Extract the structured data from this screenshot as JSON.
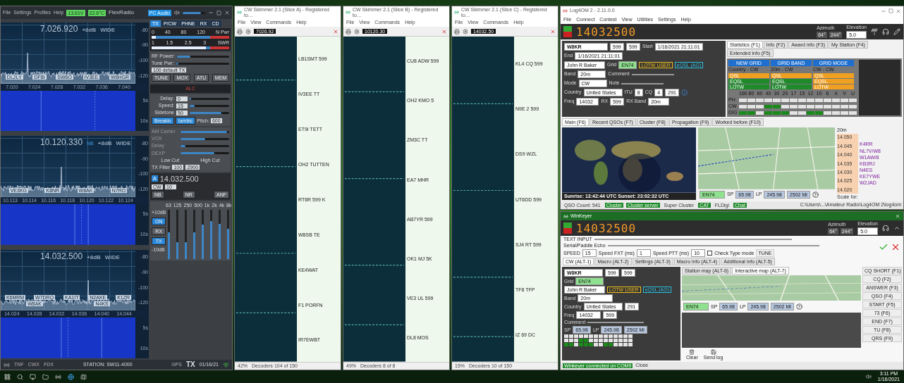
{
  "sdr": {
    "menu": [
      "File",
      "Settings",
      "Profiles",
      "Help"
    ],
    "status": [
      "13.61V",
      "22.6°C"
    ],
    "brand": "FlexRadio",
    "audio": "PC Audio",
    "volume": {
      "level": 0.8
    },
    "pans": [
      {
        "freq": "7.026.920",
        "gain": "+8dB",
        "width": "WIDE",
        "scale": [
          "-80",
          "-90",
          "-100",
          "-120"
        ],
        "ticks": [
          "7.020",
          "7.024",
          "7.028",
          "7.032",
          "7.036",
          "7.040"
        ],
        "wf_scale": [
          "5s",
          "10s"
        ],
        "spots": [
          "DL2LY",
          "DF8I",
          "SW6O",
          "IV3EE",
          "W8HGR"
        ]
      },
      {
        "freq": "10.120.330",
        "tag": "NB",
        "gain": "+8dB",
        "width": "WIDE",
        "scale": [
          "-80",
          "-90",
          "-100",
          "-120"
        ],
        "ticks": [
          "10.113",
          "10.114",
          "10.116",
          "10.118",
          "10.120",
          "10.122",
          "10.124"
        ],
        "wf_scale": [
          "5s",
          "10s"
        ],
        "spots": [
          "VE3KG",
          "K8NR",
          "W8AK",
          "N7RO"
        ]
      },
      {
        "freq": "14.032.500",
        "gain": "+8dB",
        "width": "WIDE",
        "scale": [
          "-80",
          "-90",
          "-100",
          "-120"
        ],
        "ticks": [
          "14.024",
          "14.028",
          "14.032",
          "14.036",
          "14.040",
          "14.044"
        ],
        "wf_scale": [
          "5s",
          "10s"
        ],
        "spots": [
          "K6MRM",
          "W7DRQ",
          "KA1IT",
          "N2AKE",
          "K1ZR",
          "W8AK",
          "N4KS"
        ]
      }
    ],
    "tabs": [
      {
        "label": "TX",
        "selected": true
      },
      {
        "label": "P/CW",
        "selected": false
      },
      {
        "label": "PHNE",
        "selected": false
      },
      {
        "label": "RX",
        "selected": false
      },
      {
        "label": "CD",
        "selected": false
      }
    ],
    "meters": [
      {
        "label": "N Pwr",
        "ticks": [
          "0",
          "40",
          "80",
          "120"
        ],
        "level": 0.05
      },
      {
        "label": "SWR",
        "ticks": [
          "1",
          "1.5",
          "2.5",
          "3"
        ],
        "level": 0.7
      }
    ],
    "tx_rows": [
      {
        "label": "RF Power:",
        "level": 0.25
      },
      {
        "label": "Tune Pwr:",
        "level": 0.05
      }
    ],
    "profile": "100 default TX",
    "tx_buttons": [
      {
        "label": "TUNE",
        "on": false
      },
      {
        "label": "MOX",
        "on": false
      },
      {
        "label": "ATU",
        "on": false
      },
      {
        "label": "MEM",
        "on": false
      }
    ],
    "alc_label": "ALC",
    "cw_rows": [
      {
        "label": "Delay:",
        "value": "0",
        "level": 0.03
      },
      {
        "label": "Speed:",
        "value": "15",
        "level": 0.12
      },
      {
        "label": "Sidetone",
        "value": "50",
        "level": 0.8
      }
    ],
    "cw_buttons": [
      {
        "label": "Breakin",
        "on": true
      },
      {
        "label": "Iambic",
        "on": true
      }
    ],
    "pitch_label": "Pitch:",
    "pitch": "600",
    "phone_rows": [
      {
        "label": "AM Carrier",
        "level": 0.95
      },
      {
        "label": "VOX",
        "level": 0.5
      },
      {
        "label": "Delay",
        "level": 0.1
      },
      {
        "label": "DEXP",
        "level": 0.7
      }
    ],
    "filter": {
      "label": "TX Filter",
      "low_label": "Low Cut",
      "low": "100",
      "high_label": "High Cut",
      "high": "2900"
    },
    "slice": {
      "letter": "A",
      "freq": "14.032.500",
      "mode": "CW",
      "step": "10",
      "buttons": [
        {
          "label": "NB",
          "on": false
        },
        {
          "label": "NR",
          "on": false
        },
        {
          "label": "ANF",
          "on": false
        }
      ]
    },
    "eq": {
      "bands": [
        {
          "label": "63",
          "level": 0.55
        },
        {
          "label": "125",
          "level": 0.35
        },
        {
          "label": "250",
          "level": 0.35
        },
        {
          "label": "500",
          "level": 0.55
        },
        {
          "label": "1k",
          "level": 0.7
        },
        {
          "label": "2k",
          "level": 0.78
        },
        {
          "label": "4k",
          "level": 0.72
        },
        {
          "label": "8k",
          "level": 0.62
        }
      ],
      "top": "+10dB",
      "bottom": "-10dB",
      "buttons": [
        {
          "label": "ON",
          "on": true
        },
        {
          "label": "RX",
          "on": false
        },
        {
          "label": "TX",
          "on": true
        }
      ]
    },
    "statusbar": [
      {
        "text": "TNF",
        "kind": "mode"
      },
      {
        "text": "CWX",
        "kind": "mode"
      },
      {
        "text": "FDX",
        "kind": "mode"
      },
      {
        "text": "STATION: SW11-4000",
        "kind": "station"
      },
      {
        "text": "GPS",
        "kind": "mode"
      },
      {
        "text": "TX",
        "kind": "tx"
      },
      {
        "text": "01/16/21",
        "kind": "clock"
      }
    ]
  },
  "skimmers": [
    {
      "title": "CW Skimmer 2.1 (Slice A) - Registered to…",
      "menu": [
        "File",
        "View",
        "Commands",
        "Help"
      ],
      "freq": "7026.92",
      "spots": [
        "LB1SMT 599",
        "IV3EE TT",
        "ET9I TETT",
        "OH2 TUTTEN",
        "RT6R 599 K",
        "W8SB TE",
        "KE4WAT",
        "F1 PORFN",
        "IR7EWBT"
      ],
      "status": [
        "42%",
        "Decoders 104 of 150"
      ]
    },
    {
      "title": "CW Skimmer 2.1 (Slice B) - Registered to…",
      "menu": [
        "File",
        "View",
        "Commands",
        "Help"
      ],
      "freq": "10120.30",
      "spots": [
        "CU8 ADW 599",
        "OH2 KMO 5",
        "ZM3C TT",
        "EA7 MHR",
        "AB7YR 599",
        "OK1 MJ 5K",
        "VE3 UL 599",
        "DL8 MOS"
      ],
      "status": [
        "49%",
        "Decoders 8 of 8"
      ]
    },
    {
      "title": "CW Skimmer 2.1 (Slice C) - Registered to…",
      "menu": [
        "File",
        "View",
        "Commands",
        "Help"
      ],
      "freq": "14032.50",
      "spots": [
        "KL4 CQ 599",
        "N9E 2 599",
        "DS9 WZL",
        "UT6DD 599",
        "SJ4 RT 599",
        "TF8 TFP",
        "IZ 69 DC"
      ],
      "status": [
        "15%",
        "Decoders 10 of 150"
      ]
    }
  ],
  "log": {
    "title": "Log4OM 2 - 2.11.0.0",
    "menu": [
      "File",
      "Connect",
      "Contest",
      "View",
      "Utilities",
      "Settings",
      "Help"
    ],
    "freq": "14032500",
    "azimuth_label": "Azimuth",
    "azimuth": [
      "64°",
      "244°"
    ],
    "elevation_label": "Elevation",
    "elevation": "5.0",
    "call": "W8KR",
    "rst_sent": "599",
    "rst_rcvd": "599",
    "start_label": "Start",
    "start": "1/16/2021 21:11:01",
    "end_label": "End",
    "end": "1/16/2021 21:11:01",
    "name": "John R Baker",
    "grid_label": "Grid",
    "grid": "EN74",
    "band_label": "Band",
    "band": "20m",
    "mode_label": "Mode",
    "mode": "CW",
    "comment_label": "Comment",
    "note_label": "Note",
    "country_label": "Country",
    "country": "United States",
    "itu_label": "ITU",
    "itu": "8",
    "cq_label": "CQ",
    "cq": "4",
    "dxcc": "291",
    "badges": [
      "LOTW USER",
      "eQSL (AG)"
    ],
    "freq_label": "Freq",
    "freq_short": "14032",
    "rx_label": "RX",
    "rst": "599",
    "rx_band_label": "RX Band",
    "rx_band": "20m",
    "info_tabs": [
      {
        "label": "Statistics (F1)",
        "selected": true
      },
      {
        "label": "Info (F2)",
        "selected": false
      },
      {
        "label": "Award info (F3)",
        "selected": false
      },
      {
        "label": "My Station (F4)",
        "selected": false
      },
      {
        "label": "Extended info (F5)",
        "selected": false
      }
    ],
    "stat_cols": [
      {
        "head": "NEW GRID",
        "sub": "Country - CW",
        "cells": [
          {
            "text": "QSL",
            "color": "#f0a020"
          },
          {
            "text": "EQSL",
            "color": "#1e8a2a"
          },
          {
            "text": "LOTW",
            "color": "#1e8a2a"
          }
        ]
      },
      {
        "head": "GRID BAND",
        "sub": "20m - CW",
        "cells": [
          {
            "text": "QSL",
            "color": "#f0a020"
          },
          {
            "text": "EQSL",
            "color": "#1e8a2a"
          },
          {
            "text": "LOTW",
            "color": "#1e8a2a"
          }
        ]
      },
      {
        "head": "GRID MODE",
        "sub": "CW - CW",
        "cells": [
          {
            "text": "QSL",
            "color": "#f0a020"
          },
          {
            "text": "EQSL",
            "color": "#f0a020"
          },
          {
            "text": "LOTW",
            "color": "#f0a020"
          }
        ]
      }
    ],
    "bands": [
      "160",
      "80",
      "60",
      "40",
      "30",
      "20",
      "17",
      "15",
      "12",
      "10",
      "6",
      "4",
      "V",
      "U"
    ],
    "band_rows": [
      {
        "label": "PH",
        "cells": [
          false,
          false,
          false,
          false,
          false,
          false,
          false,
          false,
          false,
          false,
          false,
          false,
          false,
          false
        ]
      },
      {
        "label": "CW",
        "cells": [
          false,
          false,
          false,
          true,
          true,
          false,
          false,
          false,
          false,
          false,
          false,
          false,
          false,
          false
        ]
      },
      {
        "label": "DIG",
        "cells": [
          true,
          true,
          false,
          true,
          true,
          true,
          false,
          false,
          true,
          true,
          false,
          false,
          false,
          false
        ]
      }
    ],
    "map_tabs": [
      {
        "label": "Main (F6)",
        "selected": true
      },
      {
        "label": "Recent QSOs (F7)",
        "selected": false
      },
      {
        "label": "Cluster (F8)",
        "selected": false
      },
      {
        "label": "Propagation (F9)",
        "selected": false
      },
      {
        "label": "Worked before (F10)",
        "selected": false
      }
    ],
    "sun": "Sunrise: 13:42:44 UTC  Sunset: 23:02:32 UTC",
    "locator": {
      "grid": "EN74",
      "sp_label": "SP",
      "sp": "65.98",
      "lp_label": "LP",
      "lp": "245.98",
      "dist": "2502 Mi"
    },
    "bandmap": {
      "band": "20m",
      "freqs": [
        "14.050",
        "14.045",
        "14.040",
        "14.035",
        "14.030",
        "14.025",
        "14.020"
      ],
      "spots": [
        "K4RR",
        "NL7V/W8",
        "W1AW/8",
        "KB3RJ",
        "N4ES",
        "KE7YWE",
        "W2JAD"
      ],
      "scale": "Scale for:"
    },
    "status": [
      {
        "text": "QSO Count: 541",
        "on": false
      },
      {
        "text": "Cluster",
        "on": true
      },
      {
        "text": "Cluster server",
        "on": true
      },
      {
        "text": "Super Cluster",
        "on": false
      },
      {
        "text": "CAT",
        "on": true
      },
      {
        "text": "FLDigi",
        "on": false
      },
      {
        "text": "Chat",
        "on": true
      }
    ],
    "db_path": "C:\\Users\\...\\Amateur Radio\\Log4OM 2\\log4om"
  },
  "keyer": {
    "title": "WinKeyer",
    "freq": "14032500",
    "azimuth_label": "Azimuth",
    "azimuth": [
      "64°",
      "244°"
    ],
    "elevation_label": "Elevation",
    "elevation": "5.0",
    "text_label": "TEXT INPUT",
    "echo_label": "Serial/Paddle Echo",
    "speed_label": "SPEED",
    "speed": "15",
    "fxt_label": "Speed FXT (ms)",
    "fxt": "1",
    "ptt_label": "Speed PTT (ms)",
    "ptt": "10",
    "check_label": "Check Type mode",
    "check": false,
    "tune": "TUNE",
    "tabs": [
      {
        "label": "CW (ALT-1)",
        "selected": true
      },
      {
        "label": "Macro (ALT-2)",
        "selected": false
      },
      {
        "label": "Settings (ALT-3)",
        "selected": false
      },
      {
        "label": "Macro info (ALT-4)",
        "selected": false
      },
      {
        "label": "Additional info (ALT-5)",
        "selected": false
      }
    ],
    "call": "W8KR",
    "rst_sent": "599",
    "rst_rcvd": "599",
    "grid_label": "Grid",
    "grid": "EN74",
    "name": "John R Baker",
    "band_label": "Band",
    "band": "20m",
    "country_label": "Country",
    "country": "United States",
    "dxcc": "291",
    "badges": [
      "LOTW USER",
      "eQSL (AG)"
    ],
    "freq_label": "Freq",
    "freq_short": "14032",
    "rst": "599",
    "comment_label": "Comment",
    "sp_label": "SP",
    "sp": "65.98",
    "lp_label": "LP",
    "lp": "245.98",
    "dist": "2502 Mi",
    "band_rows": [
      {
        "cells": [
          false,
          false,
          false,
          false,
          false,
          false,
          false,
          false,
          false,
          false,
          false,
          false,
          false,
          false
        ]
      },
      {
        "cells": [
          false,
          false,
          false,
          true,
          true,
          false,
          false,
          false,
          false,
          false,
          false,
          false,
          false,
          false
        ]
      },
      {
        "cells": [
          true,
          true,
          false,
          true,
          true,
          true,
          false,
          false,
          true,
          true,
          false,
          false,
          false,
          false
        ]
      }
    ],
    "map_tabs": [
      {
        "label": "Station map (ALT-6)",
        "selected": false
      },
      {
        "label": "Interactive map (ALT-7)",
        "selected": true
      }
    ],
    "locator": {
      "grid": "EN74",
      "sp_label": "SP",
      "sp": "65.98",
      "lp_label": "LP",
      "lp": "245.98",
      "dist": "2502 Mi"
    },
    "macros": [
      "CQ SHORT (F1)",
      "CQ (F2)",
      "ANSWER (F3)",
      "QSO (F4)",
      "START (F5)",
      "73 (F6)",
      "END (F7)",
      "TU (F8)",
      "QRS (F9)"
    ],
    "actions": [
      "Clear",
      "Send log"
    ],
    "status": "Winkeyer connected on COM9",
    "close": "Close"
  },
  "taskbar": {
    "time": "3:11 PM",
    "date": "1/16/2021"
  }
}
